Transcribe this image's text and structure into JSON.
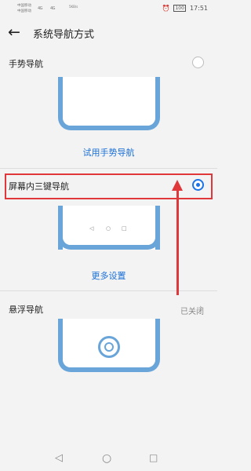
{
  "status_bar": {
    "carrier_1": "中国移动",
    "carrier_2": "中国移动",
    "network_1": "4G",
    "network_2": "4G",
    "speed": "5KB/s",
    "battery": "100",
    "time": "17:51"
  },
  "header": {
    "back_icon": "arrow-left-icon",
    "title": "系统导航方式"
  },
  "options": [
    {
      "label": "手势导航",
      "selected": false,
      "action": "试用手势导航"
    },
    {
      "label": "屏幕内三键导航",
      "selected": true,
      "action": "更多设置"
    },
    {
      "label": "悬浮导航",
      "status": "已关闭"
    }
  ],
  "system_nav": {
    "back_icon": "triangle-back-icon",
    "home_icon": "circle-home-icon",
    "recent_icon": "square-recent-icon"
  },
  "colors": {
    "accent": "#1a73e8",
    "annotation": "#e0373a",
    "phone_frame": "#6aa5d9"
  }
}
